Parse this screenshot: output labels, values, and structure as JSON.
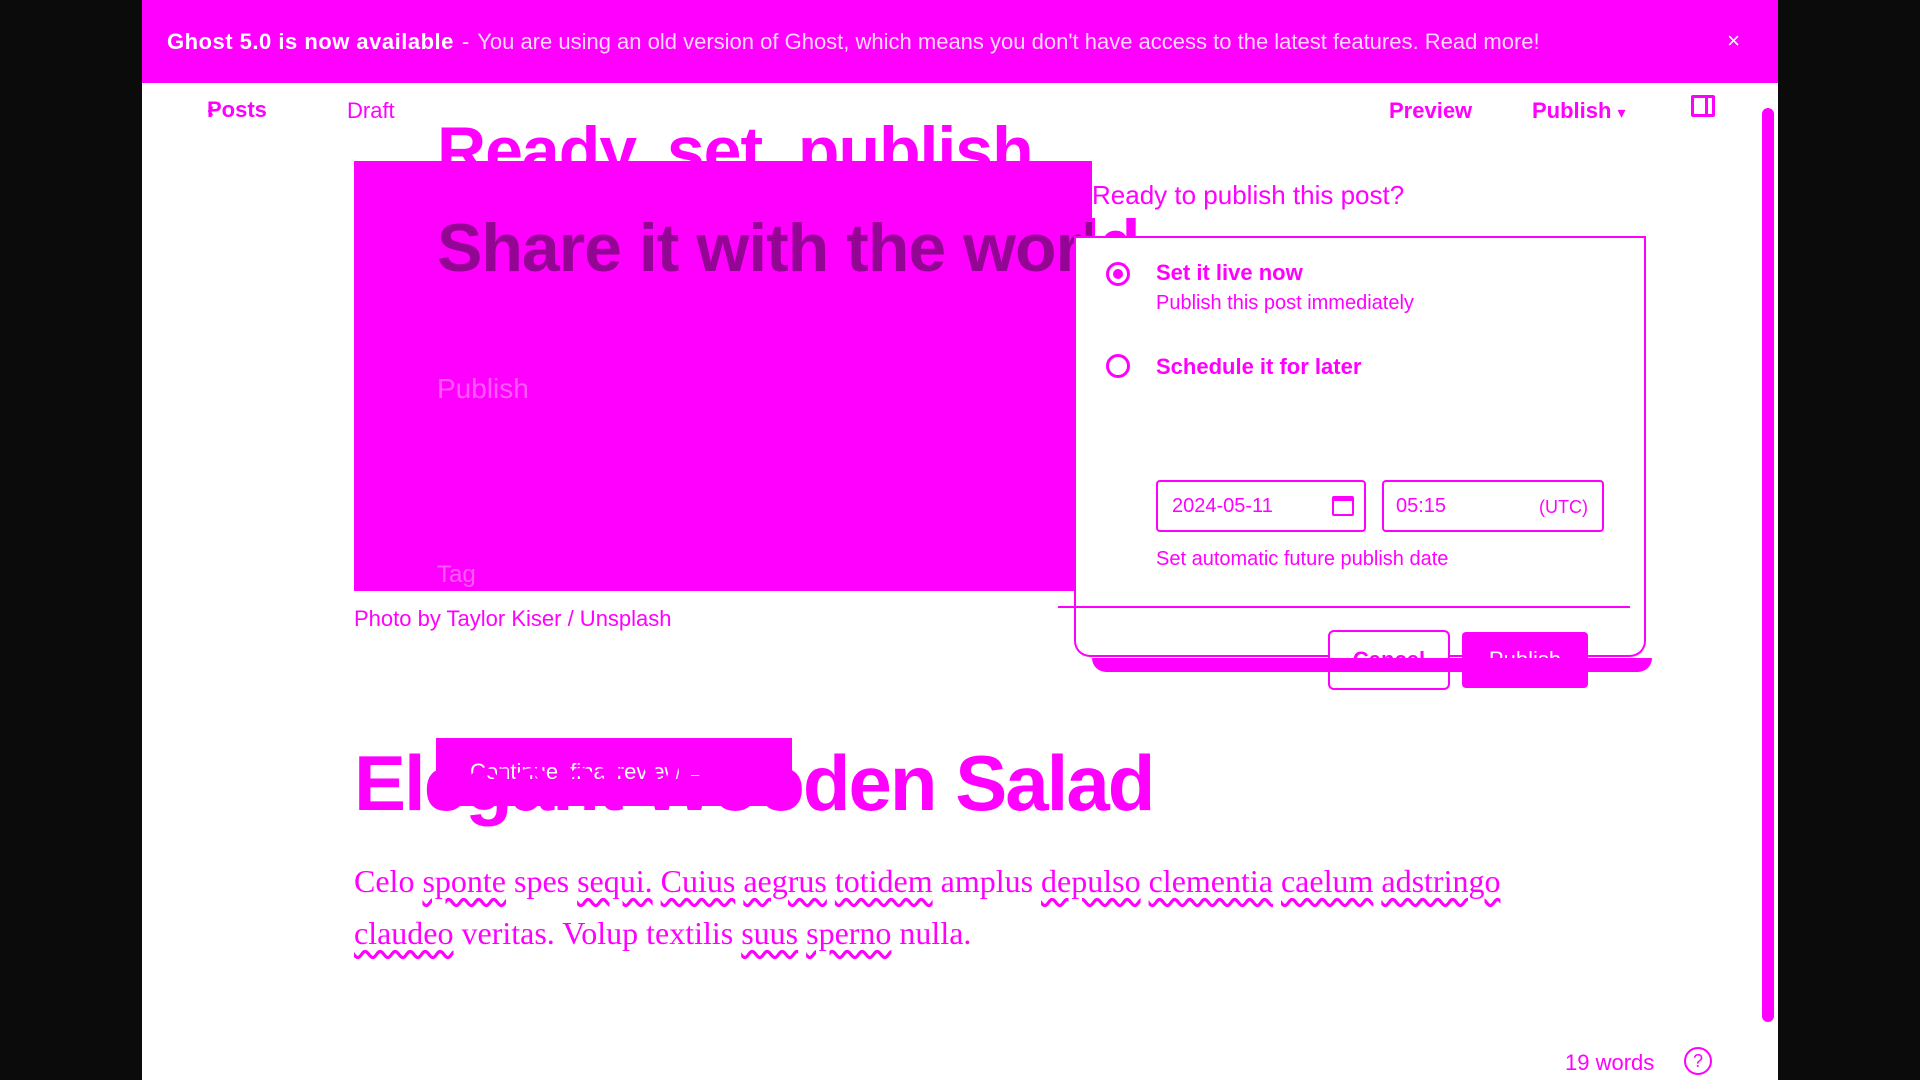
{
  "banner": {
    "title": "Ghost 5.0 is now available",
    "separator": "-",
    "message": "You are using an old version of Ghost, which means you don't have access to the latest features. Read more!",
    "close_glyph": "×"
  },
  "header": {
    "back_label": "Posts",
    "status": "Draft",
    "preview_label": "Preview",
    "publish_label": "Publish"
  },
  "hero": {
    "line1": "Ready, set, publish.",
    "line2": "Share it with the world."
  },
  "feature": {
    "ghost_publish": "Publish",
    "ghost_tag": "Tag"
  },
  "caption": "Photo by Taylor Kiser / Unsplash",
  "publish_modal": {
    "title": "Ready to publish this post?",
    "option_now_label": "Set it live now",
    "option_now_sub": "Publish this post immediately",
    "option_later_label": "Schedule it for later",
    "date_value": "2024-05-11",
    "time_value": "05:15",
    "timezone": "(UTC)",
    "hint": "Set automatic future publish date",
    "cancel_label": "Cancel",
    "publish_button_label": "Publish"
  },
  "continue_label": "Continue, final review →",
  "post": {
    "title": "Elegant Wooden Salad",
    "body_words": [
      "Celo",
      "sponte",
      "spes",
      "sequi.",
      "Cuius",
      "aegrus",
      "totidem",
      "amplus",
      "depulso",
      "clementia",
      "caelum",
      "adstringo",
      "claudeo",
      "veritas.",
      "Volup",
      "textilis",
      "suus",
      "sperno",
      "nulla."
    ]
  },
  "footer": {
    "word_count": "19 words",
    "help_glyph": "?"
  },
  "colors": {
    "accent": "#ff00ff",
    "background": "#ffffff",
    "outer": "#0b0b0b"
  }
}
